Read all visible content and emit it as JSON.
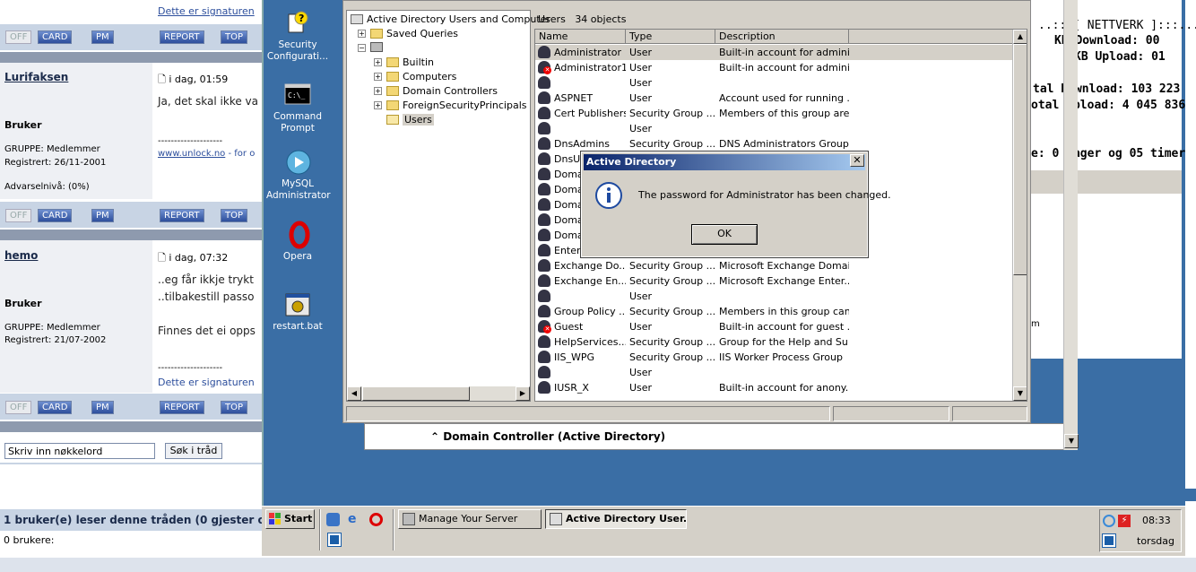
{
  "forum": {
    "top_signature": "Dette er signaturen",
    "buttons": {
      "off": "OFF",
      "card": "CARD",
      "pm": "PM",
      "report": "REPORT",
      "top": "TOP"
    },
    "posts": [
      {
        "user": "Lurifaksen",
        "date": "i dag, 01:59",
        "rank": "Bruker",
        "group": "GRUPPE: Medlemmer",
        "registered": "Registrert: 26/11-2001",
        "warning": "Advarselnivå: (0%)",
        "text": "Ja, det skal ikke va",
        "dashes": "--------------------",
        "link": "www.unlock.no",
        "link_suffix": " - for o"
      },
      {
        "user": "hemo",
        "date": "i dag, 07:32",
        "rank": "Bruker",
        "group": "GRUPPE: Medlemmer",
        "registered": "Registrert: 21/07-2002",
        "line1": "..eg får ikkje trykt",
        "line2": "..tilbakestill passo",
        "line3": "Finnes det ei opps",
        "dashes": "--------------------",
        "signature": "Dette er signaturen"
      }
    ],
    "search_placeholder": "Skriv inn nøkkelord",
    "search_button": "Søk i tråd",
    "readers": "1 bruker(e) leser denne tråden (0 gjester og",
    "members": "0 brukere:"
  },
  "desktop_icons": [
    {
      "label": "Security Configurati...",
      "icon": "security-config-icon"
    },
    {
      "label": "Command Prompt",
      "icon": "command-prompt-icon"
    },
    {
      "label": "MySQL Administrator",
      "icon": "mysql-icon"
    },
    {
      "label": "Opera",
      "icon": "opera-icon"
    },
    {
      "label": "restart.bat",
      "icon": "batch-file-icon"
    }
  ],
  "stats": {
    "header": "..:::[ NETTVERK ]:::...",
    "kb_download": "KB Download:   00",
    "kb_upload": "KB Upload:   01",
    "total_download": "tal Download: 103 223",
    "total_upload": "otal Upload: 4 045 836",
    "uptime": "e:  0 dager og 05 timer",
    "m": "m"
  },
  "ad": {
    "root": "Active Directory Users and Computer",
    "tree": [
      "Saved Queries",
      "Builtin",
      "Computers",
      "Domain Controllers",
      "ForeignSecurityPrincipals",
      "Users"
    ],
    "header_title": "Users",
    "header_count": "34 objects",
    "columns": [
      "Name",
      "Type",
      "Description"
    ],
    "rows": [
      {
        "name": "Administrator",
        "type": "User",
        "desc": "Built-in account for admini...",
        "status": "selected"
      },
      {
        "name": "Administrator1",
        "type": "User",
        "desc": "Built-in account for admini...",
        "status": "disabled"
      },
      {
        "name": "",
        "type": "User",
        "desc": "",
        "status": ""
      },
      {
        "name": "ASPNET",
        "type": "User",
        "desc": "Account used for running ...",
        "status": ""
      },
      {
        "name": "Cert Publishers",
        "type": "Security Group ...",
        "desc": "Members of this group are...",
        "status": ""
      },
      {
        "name": "",
        "type": "User",
        "desc": "",
        "status": ""
      },
      {
        "name": "DnsAdmins",
        "type": "Security Group ...",
        "desc": "DNS Administrators Group",
        "status": ""
      },
      {
        "name": "DnsUp",
        "type": "",
        "desc": "",
        "status": ""
      },
      {
        "name": "Domai",
        "type": "",
        "desc": "",
        "status": ""
      },
      {
        "name": "Domai",
        "type": "",
        "desc": "",
        "status": ""
      },
      {
        "name": "Domai",
        "type": "",
        "desc": "",
        "status": ""
      },
      {
        "name": "Domai",
        "type": "",
        "desc": "",
        "status": ""
      },
      {
        "name": "Domai",
        "type": "",
        "desc": "",
        "status": ""
      },
      {
        "name": "Enterp",
        "type": "",
        "desc": "",
        "status": ""
      },
      {
        "name": "Exchange Do...",
        "type": "Security Group ...",
        "desc": "Microsoft Exchange Domai...",
        "status": ""
      },
      {
        "name": "Exchange En...",
        "type": "Security Group ...",
        "desc": "Microsoft Exchange Enter...",
        "status": ""
      },
      {
        "name": "",
        "type": "User",
        "desc": "",
        "status": ""
      },
      {
        "name": "Group Policy ...",
        "type": "Security Group ...",
        "desc": "Members in this group can...",
        "status": ""
      },
      {
        "name": "Guest",
        "type": "User",
        "desc": "Built-in account for guest ...",
        "status": "disabled"
      },
      {
        "name": "HelpServices...",
        "type": "Security Group ...",
        "desc": "Group for the Help and Su...",
        "status": ""
      },
      {
        "name": "IIS_WPG",
        "type": "Security Group ...",
        "desc": "IIS Worker Process Group",
        "status": ""
      },
      {
        "name": "",
        "type": "User",
        "desc": "",
        "status": ""
      },
      {
        "name": "IUSR_X",
        "type": "User",
        "desc": "Built-in account for anony...",
        "status": ""
      }
    ],
    "behind_panel": "Domain Controller (Active Directory)"
  },
  "dialog": {
    "title": "Active Directory",
    "message": "The password for Administrator has been changed.",
    "ok": "OK"
  },
  "taskbar": {
    "start": "Start",
    "tasks": [
      "Manage Your Server",
      "Active Directory User..."
    ],
    "time": "08:33",
    "day": "torsdag"
  }
}
